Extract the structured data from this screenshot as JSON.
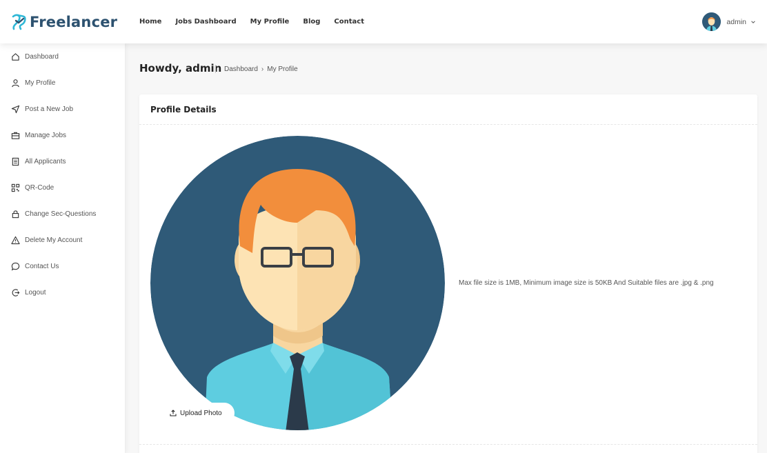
{
  "brand": {
    "name": "Freelancer"
  },
  "nav": {
    "items": [
      "Home",
      "Jobs Dashboard",
      "My Profile",
      "Blog",
      "Contact"
    ]
  },
  "user": {
    "name": "admin"
  },
  "sidebar": {
    "items": [
      {
        "label": "Dashboard",
        "icon": "home-icon"
      },
      {
        "label": "My Profile",
        "icon": "user-icon"
      },
      {
        "label": "Post a New Job",
        "icon": "send-icon"
      },
      {
        "label": "Manage Jobs",
        "icon": "briefcase-icon"
      },
      {
        "label": "All Applicants",
        "icon": "document-icon"
      },
      {
        "label": "QR-Code",
        "icon": "qr-code-icon"
      },
      {
        "label": "Change Sec-Questions",
        "icon": "lock-icon"
      },
      {
        "label": "Delete My Account",
        "icon": "warning-icon"
      },
      {
        "label": "Contact Us",
        "icon": "chat-icon"
      },
      {
        "label": "Logout",
        "icon": "logout-icon"
      }
    ]
  },
  "page": {
    "title": "Howdy, admin",
    "breadcrumb": [
      "Dashboard",
      "My Profile"
    ]
  },
  "card": {
    "title": "Profile Details",
    "upload_label": "Upload Photo",
    "hint": "Max file size is 1MB, Minimum image size is 50KB And Suitable files are .jpg & .png"
  },
  "colors": {
    "brand": "#2d5270",
    "avatar_bg": "#2f5a78",
    "hair": "#f28e3c",
    "shirt": "#5ecde0",
    "tie": "#2b3a4a"
  }
}
